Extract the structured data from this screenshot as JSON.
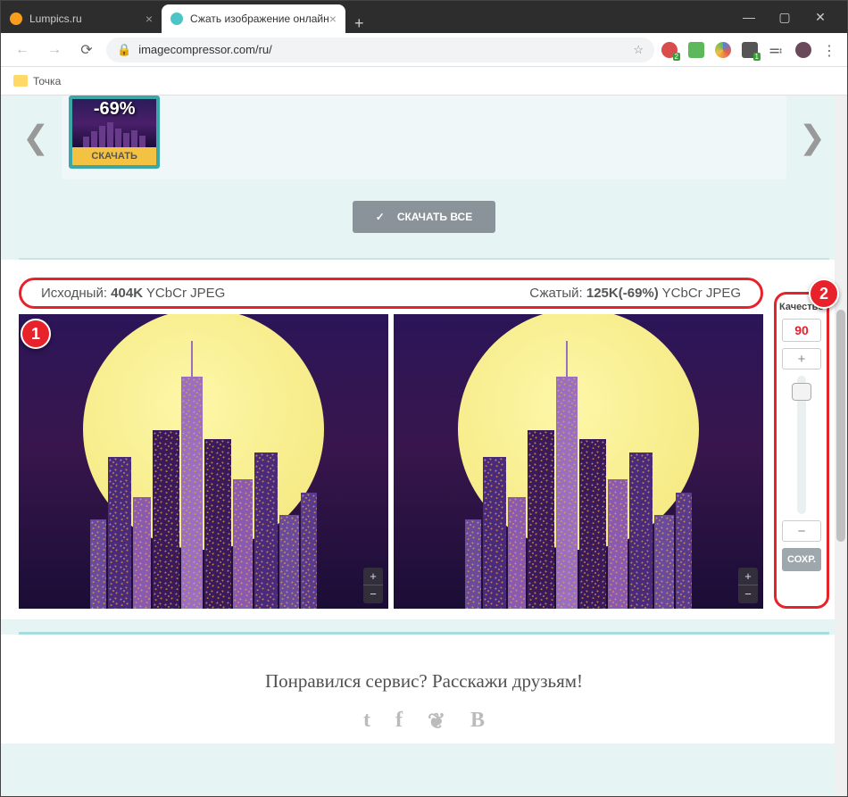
{
  "tabs": {
    "inactive": {
      "title": "Lumpics.ru"
    },
    "active": {
      "title": "Сжать изображение онлайн"
    }
  },
  "address_bar": {
    "url": "imagecompressor.com/ru/"
  },
  "bookmarks": {
    "folder1": "Точка"
  },
  "thumb": {
    "reduction": "-69%",
    "download_label": "СКАЧАТЬ"
  },
  "download_all": "СКАЧАТЬ ВСЕ",
  "info": {
    "source_label": "Исходный: ",
    "source_size": "404K",
    "source_fmt": " YCbCr JPEG",
    "compressed_label": "Сжатый: ",
    "compressed_size": "125K(-69%)",
    "compressed_fmt": " YCbCr JPEG"
  },
  "quality": {
    "label": "Качество",
    "value": "90",
    "plus": "+",
    "minus": "−",
    "save": "СОХР."
  },
  "callouts": {
    "one": "1",
    "two": "2"
  },
  "share": {
    "heading": "Понравился сервис? Расскажи друзьям!",
    "t": "t",
    "f": "f",
    "r": "❦",
    "b": "B"
  },
  "zoom": {
    "in": "+",
    "out": "−"
  }
}
